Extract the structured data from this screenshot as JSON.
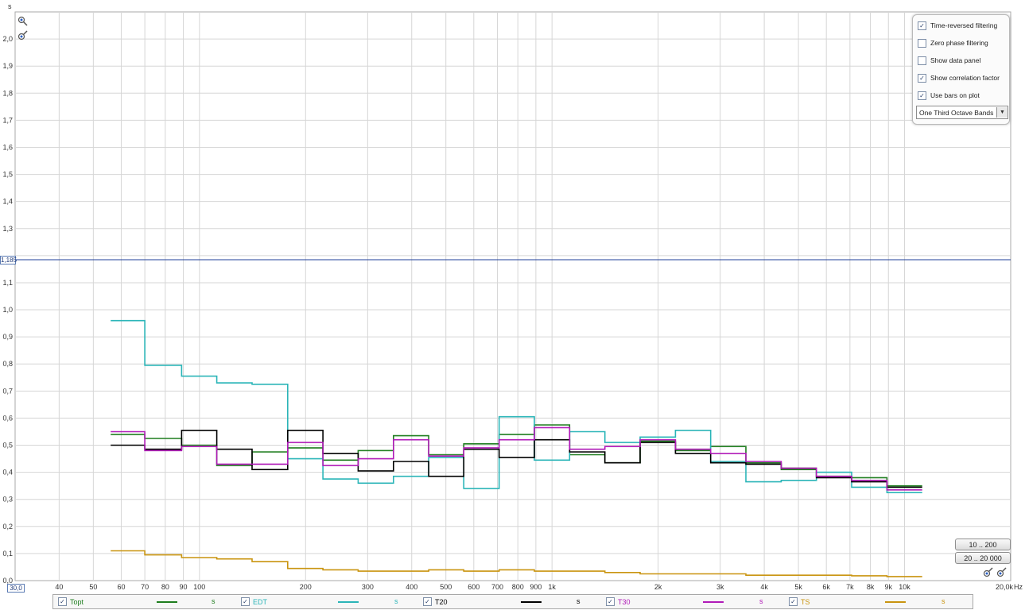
{
  "axis": {
    "y_unit": "s",
    "x_unit": "Hz",
    "x_end_label": "20,0k",
    "origin_label": "30,0",
    "reference_value": 1.185,
    "reference_label": "1,185",
    "reference_color": "#1f3f9a"
  },
  "options": {
    "time_reversed": {
      "label": "Time-reversed filtering",
      "checked": true
    },
    "zero_phase": {
      "label": "Zero phase filtering",
      "checked": false
    },
    "data_panel": {
      "label": "Show data panel",
      "checked": false
    },
    "correlation": {
      "label": "Show correlation factor",
      "checked": true
    },
    "bars": {
      "label": "Use bars on plot",
      "checked": true
    },
    "band_mode": "One Third Octave Bands"
  },
  "buttons": {
    "range_low": "10 .. 200",
    "range_full": "20 .. 20 000"
  },
  "icons": {
    "zoom_in": "zoom-in-icon",
    "zoom_out": "zoom-out-icon",
    "dropdown": "chevron-down-icon",
    "check": "✓"
  },
  "legend": [
    {
      "name": "Topt",
      "unit": "s",
      "color": "#1e7d1e",
      "checked": true
    },
    {
      "name": "EDT",
      "unit": "s",
      "color": "#2bb5b8",
      "checked": true
    },
    {
      "name": "T20",
      "unit": "s",
      "color": "#000000",
      "checked": true
    },
    {
      "name": "T30",
      "unit": "s",
      "color": "#b01ab8",
      "checked": true
    },
    {
      "name": "TS",
      "unit": "s",
      "color": "#c9940f",
      "checked": true
    }
  ],
  "chart_data": {
    "type": "line",
    "step": true,
    "x_scale": "log",
    "xlim": [
      30,
      20000
    ],
    "ylim": [
      0,
      2.1
    ],
    "ylabel": "s",
    "xlabel": "Hz",
    "grid": true,
    "legend_position": "bottom",
    "x_ticks": [
      {
        "v": 40,
        "label": "40"
      },
      {
        "v": 50,
        "label": "50"
      },
      {
        "v": 60,
        "label": "60"
      },
      {
        "v": 70,
        "label": "70"
      },
      {
        "v": 80,
        "label": "80"
      },
      {
        "v": 90,
        "label": "90"
      },
      {
        "v": 100,
        "label": "100"
      },
      {
        "v": 200,
        "label": "200"
      },
      {
        "v": 300,
        "label": "300"
      },
      {
        "v": 400,
        "label": "400"
      },
      {
        "v": 500,
        "label": "500"
      },
      {
        "v": 600,
        "label": "600"
      },
      {
        "v": 700,
        "label": "700"
      },
      {
        "v": 800,
        "label": "800"
      },
      {
        "v": 900,
        "label": "900"
      },
      {
        "v": 1000,
        "label": "1k"
      },
      {
        "v": 2000,
        "label": "2k"
      },
      {
        "v": 3000,
        "label": "3k"
      },
      {
        "v": 4000,
        "label": "4k"
      },
      {
        "v": 5000,
        "label": "5k"
      },
      {
        "v": 6000,
        "label": "6k"
      },
      {
        "v": 7000,
        "label": "7k"
      },
      {
        "v": 8000,
        "label": "8k"
      },
      {
        "v": 9000,
        "label": "9k"
      },
      {
        "v": 10000,
        "label": "10k"
      }
    ],
    "y_ticks": [
      {
        "v": 0.0,
        "label": "0,0"
      },
      {
        "v": 0.1,
        "label": "0,1"
      },
      {
        "v": 0.2,
        "label": "0,2"
      },
      {
        "v": 0.3,
        "label": "0,3"
      },
      {
        "v": 0.4,
        "label": "0,4"
      },
      {
        "v": 0.5,
        "label": "0,5"
      },
      {
        "v": 0.6,
        "label": "0,6"
      },
      {
        "v": 0.7,
        "label": "0,7"
      },
      {
        "v": 0.8,
        "label": "0,8"
      },
      {
        "v": 0.9,
        "label": "0,9"
      },
      {
        "v": 1.0,
        "label": "1,0"
      },
      {
        "v": 1.1,
        "label": "1,1"
      },
      {
        "v": 1.3,
        "label": "1,3"
      },
      {
        "v": 1.4,
        "label": "1,4"
      },
      {
        "v": 1.5,
        "label": "1,5"
      },
      {
        "v": 1.6,
        "label": "1,6"
      },
      {
        "v": 1.7,
        "label": "1,7"
      },
      {
        "v": 1.8,
        "label": "1,8"
      },
      {
        "v": 1.9,
        "label": "1,9"
      },
      {
        "v": 2.0,
        "label": "2,0"
      }
    ],
    "band_edges": [
      56,
      70,
      89,
      112,
      141,
      178,
      224,
      282,
      355,
      447,
      562,
      708,
      891,
      1122,
      1413,
      1778,
      2239,
      2818,
      3548,
      4467,
      5623,
      7079,
      8913,
      11220
    ],
    "series": [
      {
        "name": "Topt",
        "color": "#1e7d1e",
        "values": [
          0.54,
          0.525,
          0.5,
          0.425,
          0.475,
          0.49,
          0.445,
          0.48,
          0.535,
          0.465,
          0.505,
          0.54,
          0.575,
          0.465,
          0.435,
          0.515,
          0.48,
          0.495,
          0.435,
          0.41,
          0.385,
          0.38,
          0.35
        ]
      },
      {
        "name": "EDT",
        "color": "#2bb5b8",
        "values": [
          0.96,
          0.795,
          0.755,
          0.73,
          0.725,
          0.45,
          0.375,
          0.36,
          0.385,
          0.455,
          0.34,
          0.605,
          0.445,
          0.55,
          0.51,
          0.53,
          0.555,
          0.44,
          0.365,
          0.37,
          0.4,
          0.345,
          0.325
        ]
      },
      {
        "name": "T20",
        "color": "#000000",
        "values": [
          0.5,
          0.485,
          0.555,
          0.485,
          0.41,
          0.555,
          0.47,
          0.405,
          0.44,
          0.385,
          0.485,
          0.455,
          0.52,
          0.475,
          0.435,
          0.51,
          0.47,
          0.435,
          0.43,
          0.415,
          0.38,
          0.365,
          0.345
        ]
      },
      {
        "name": "T30",
        "color": "#b01ab8",
        "values": [
          0.55,
          0.48,
          0.495,
          0.43,
          0.43,
          0.51,
          0.425,
          0.45,
          0.52,
          0.46,
          0.49,
          0.52,
          0.565,
          0.485,
          0.495,
          0.52,
          0.485,
          0.47,
          0.44,
          0.415,
          0.385,
          0.37,
          0.335
        ]
      },
      {
        "name": "TS",
        "color": "#c9940f",
        "values": [
          0.11,
          0.095,
          0.085,
          0.08,
          0.07,
          0.045,
          0.04,
          0.035,
          0.035,
          0.04,
          0.035,
          0.04,
          0.035,
          0.035,
          0.03,
          0.025,
          0.025,
          0.025,
          0.02,
          0.02,
          0.02,
          0.018,
          0.015
        ]
      }
    ]
  }
}
